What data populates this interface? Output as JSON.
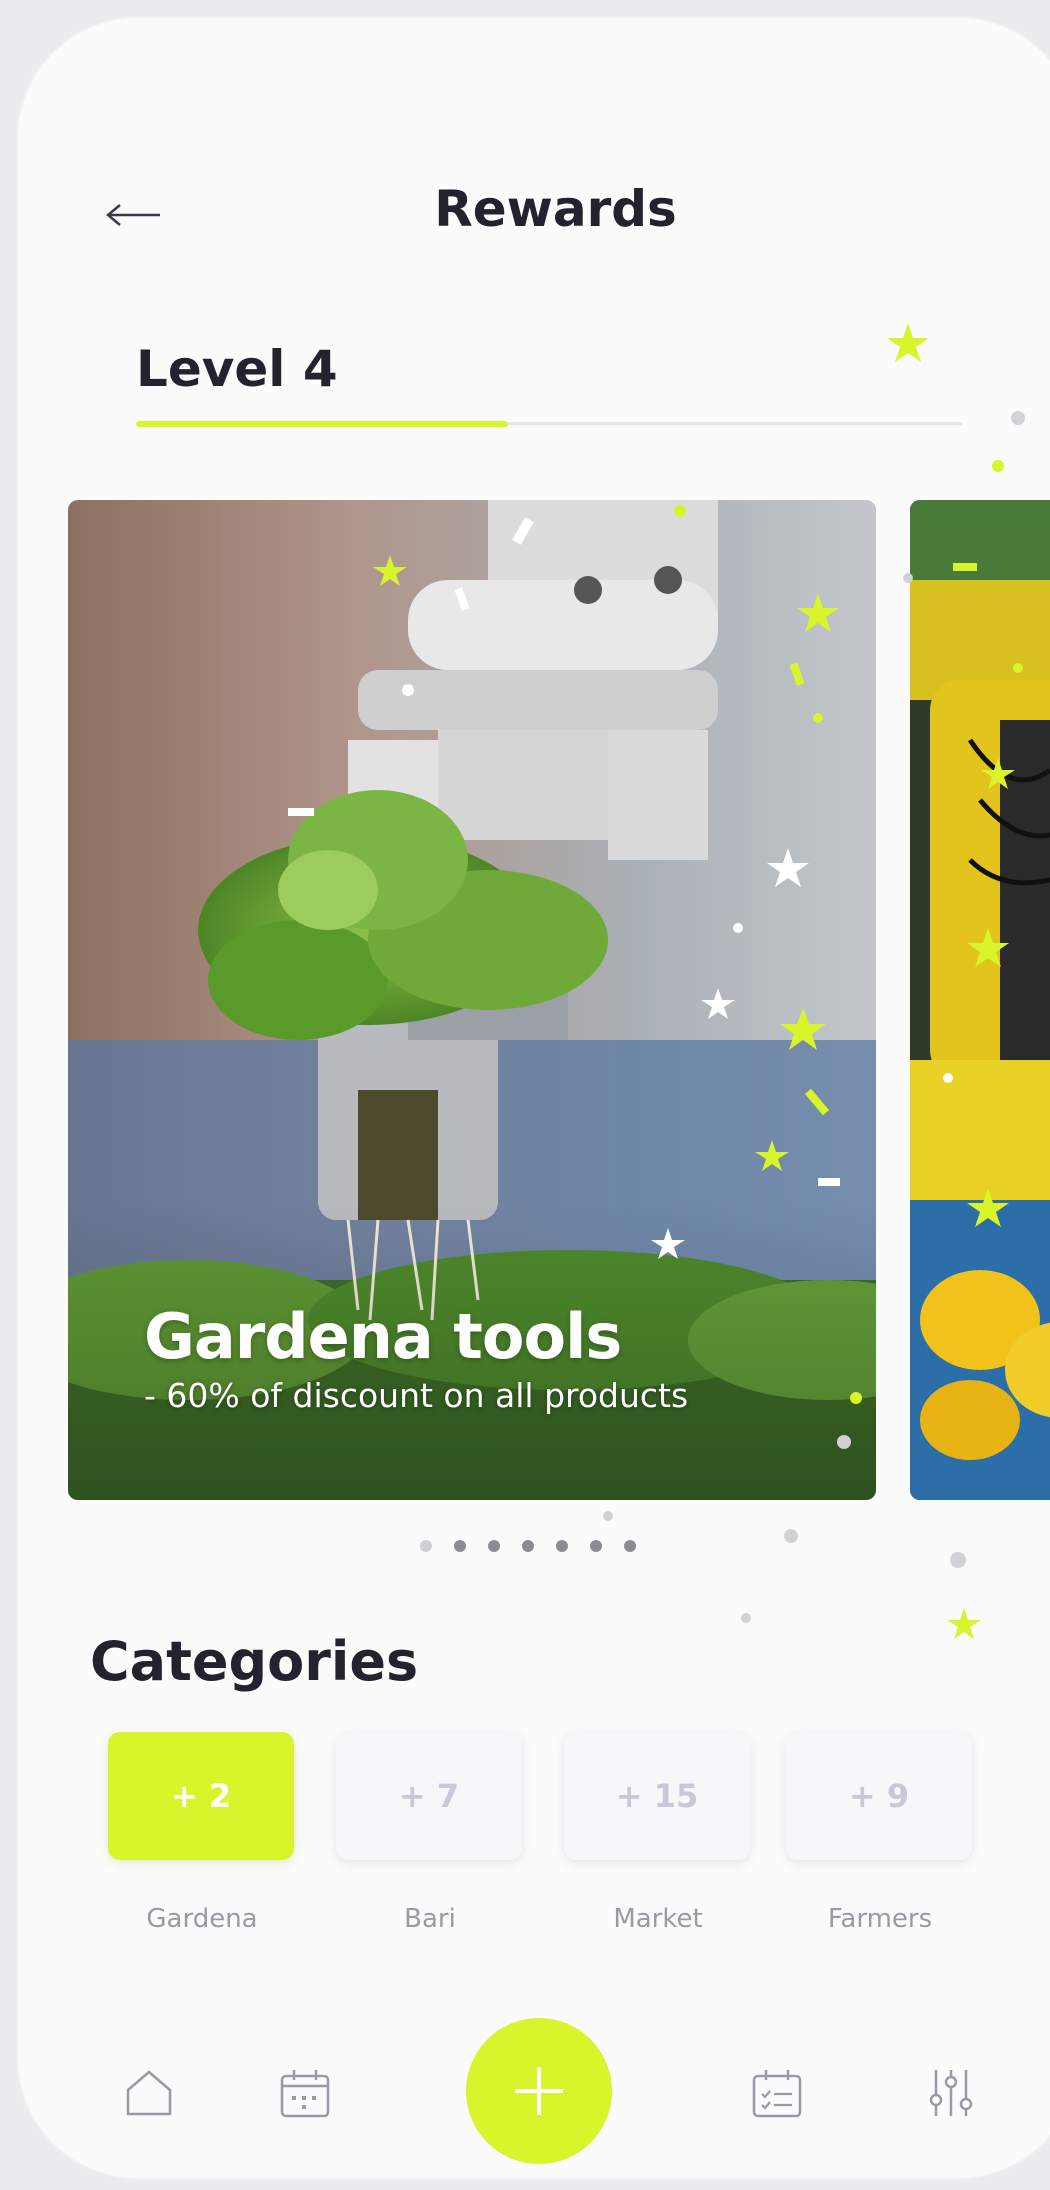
{
  "header": {
    "title": "Rewards",
    "back_icon": "arrow-left-icon"
  },
  "level": {
    "label": "Level 4",
    "progress": 0.45,
    "accent_color": "#d8f42a"
  },
  "carousel": {
    "cards": [
      {
        "title": "Gardena tools",
        "subtitle": "- 60% of discount on all products",
        "image": "lettuce-robot-arm-photo"
      },
      {
        "image": "yellow-peppers-robot-photo"
      }
    ],
    "page_count": 7,
    "active_page": 1
  },
  "categories": {
    "title": "Categories",
    "items": [
      {
        "value": "+ 2",
        "label": "Gardena",
        "active": true
      },
      {
        "value": "+ 7",
        "label": "Bari",
        "active": false
      },
      {
        "value": "+ 15",
        "label": "Market",
        "active": false
      },
      {
        "value": "+ 9",
        "label": "Farmers",
        "active": false
      }
    ]
  },
  "tabbar": {
    "items": [
      "home-icon",
      "calendar-icon",
      "add-icon",
      "calendar-check-icon",
      "filters-icon"
    ],
    "fab_color": "#d8f42a"
  }
}
